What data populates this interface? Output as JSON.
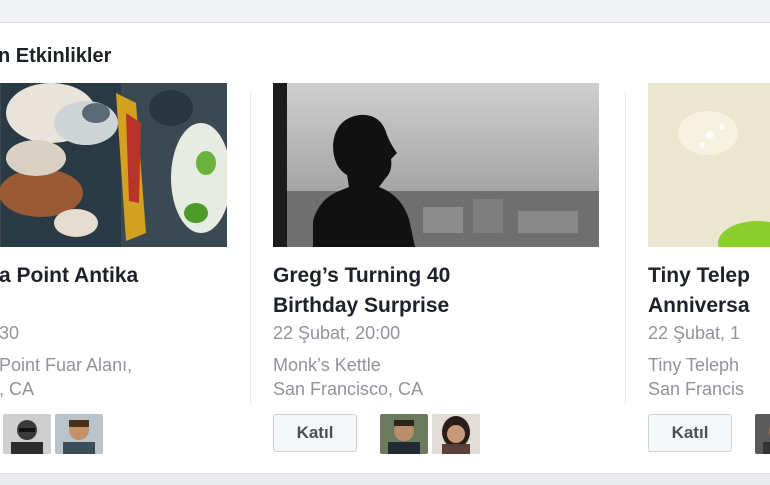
{
  "section": {
    "heading": "n Etkinlikler"
  },
  "events": [
    {
      "title_lines": [
        "a Point Antika",
        ""
      ],
      "date": "30",
      "venue_lines": [
        "Point Fuar Alanı,",
        ", CA"
      ]
    },
    {
      "title_lines": [
        "Greg’s Turning 40",
        "Birthday Surprise"
      ],
      "date": "22 Şubat, 20:00",
      "venue_lines": [
        "Monk’s Kettle",
        "San Francisco, CA"
      ],
      "join_label": "Katıl"
    },
    {
      "title_lines": [
        "Tiny Telep",
        "Anniversa"
      ],
      "date": "22 Şubat, 1",
      "venue_lines": [
        "Tiny Teleph",
        "San Francis"
      ],
      "join_label": "Katıl"
    }
  ]
}
